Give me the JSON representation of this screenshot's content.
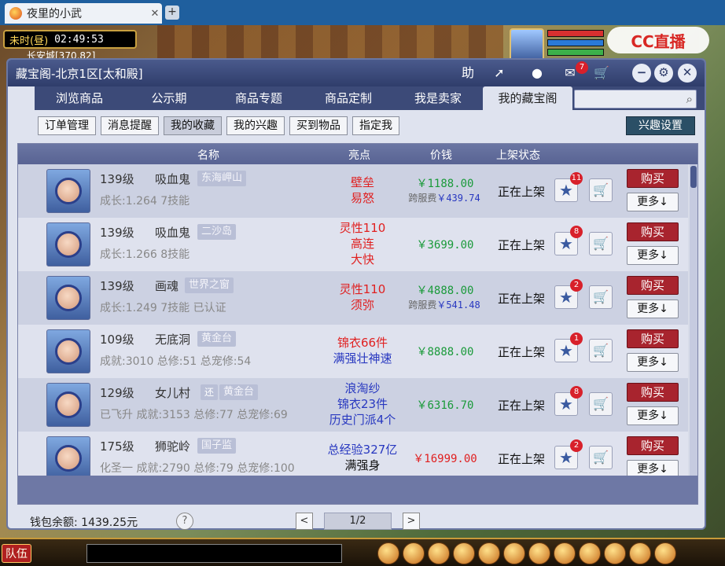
{
  "browser": {
    "tab_title": "夜里的小武",
    "close_glyph": "✕",
    "new_tab_glyph": "+"
  },
  "game": {
    "time_label": "未时(昼)",
    "clock": "02:49:53",
    "location": "长安城[370,82]",
    "watermark": "CC直播",
    "team_button": "队伍",
    "hud_colors": {
      "hp": "#d83030",
      "mp": "#2a7ad8",
      "sp": "#3cb04a"
    }
  },
  "dialog": {
    "title": "藏宝阁-北京1区[太和殿]",
    "toolbar": {
      "help_label": "助",
      "message_badge": "7"
    },
    "nav_tabs": [
      "浏览商品",
      "公示期",
      "商品专题",
      "商品定制",
      "我是卖家",
      "我的藏宝阁"
    ],
    "active_nav": 5,
    "search_placeholder": "",
    "sub_tabs": [
      "订单管理",
      "消息提醒",
      "我的收藏",
      "我的兴趣",
      "买到物品",
      "指定我"
    ],
    "active_sub": 2,
    "interest_settings": "兴趣设置",
    "columns": [
      "名称",
      "亮点",
      "价钱",
      "上架状态"
    ],
    "rows": [
      {
        "level": "139级",
        "school": "吸血鬼",
        "server": "东海岬山",
        "desc": "成长:1.264 7技能",
        "highlight": [
          "壁垒",
          "易怒"
        ],
        "highlight_color": "#e02020",
        "price": "￥1188.00",
        "price_color": "#1a9a3a",
        "fee_label": "跨服费",
        "fee": "￥439.74",
        "status": "正在上架",
        "fav_count": "11",
        "buy": "购买",
        "more": "更多↓"
      },
      {
        "level": "139级",
        "school": "吸血鬼",
        "server": "二沙岛",
        "desc": "成长:1.266 8技能",
        "highlight": [
          "灵性110",
          "高连",
          "大快"
        ],
        "highlight_color": "#e02020",
        "price": "￥3699.00",
        "price_color": "#1a9a3a",
        "fee_label": "",
        "fee": "",
        "status": "正在上架",
        "fav_count": "8",
        "buy": "购买",
        "more": "更多↓"
      },
      {
        "level": "139级",
        "school": "画魂",
        "server": "世界之窗",
        "desc": "成长:1.249 7技能 已认证",
        "highlight": [
          "灵性110",
          "须弥"
        ],
        "highlight_color": "#e02020",
        "price": "￥4888.00",
        "price_color": "#1a9a3a",
        "fee_label": "跨服费",
        "fee": "￥541.48",
        "status": "正在上架",
        "fav_count": "2",
        "buy": "购买",
        "more": "更多↓"
      },
      {
        "level": "109级",
        "school": "无底洞",
        "server": "黄金台",
        "desc": "成就:3010 总修:51 总宠修:54",
        "highlight": [
          "锦衣66件",
          "满强壮神速"
        ],
        "highlight_color": "#e02020",
        "highlight_color2": "#2838c0",
        "price": "￥8888.00",
        "price_color": "#1a9a3a",
        "fee_label": "",
        "fee": "",
        "status": "正在上架",
        "fav_count": "1",
        "buy": "购买",
        "more": "更多↓"
      },
      {
        "level": "129级",
        "school": "女儿村",
        "tag": "还",
        "server": "黄金台",
        "desc": "已飞升 成就:3153 总修:77 总宠修:69",
        "highlight": [
          "浪淘纱",
          "锦衣23件",
          "历史门派4个"
        ],
        "highlight_color": "#2838c0",
        "price": "￥6316.70",
        "price_color": "#1a9a3a",
        "fee_label": "",
        "fee": "",
        "status": "正在上架",
        "fav_count": "8",
        "buy": "购买",
        "more": "更多↓"
      },
      {
        "level": "175级",
        "school": "狮驼岭",
        "server": "国子监",
        "desc": "化圣一 成就:2790 总修:79 总宠修:100",
        "highlight": [
          "总经验327亿",
          "满强身"
        ],
        "highlight_color": "#2838c0",
        "highlight_color2": "#111111",
        "price": "￥16999.00",
        "price_color": "#e02020",
        "fee_label": "",
        "fee": "",
        "status": "正在上架",
        "fav_count": "2",
        "buy": "购买",
        "more": "更多↓"
      }
    ],
    "wallet_label": "钱包余额:",
    "wallet_amount": "1439.25元",
    "help_glyph": "?",
    "page_prev": "<",
    "page_next": ">",
    "page_indicator": "1/2"
  }
}
